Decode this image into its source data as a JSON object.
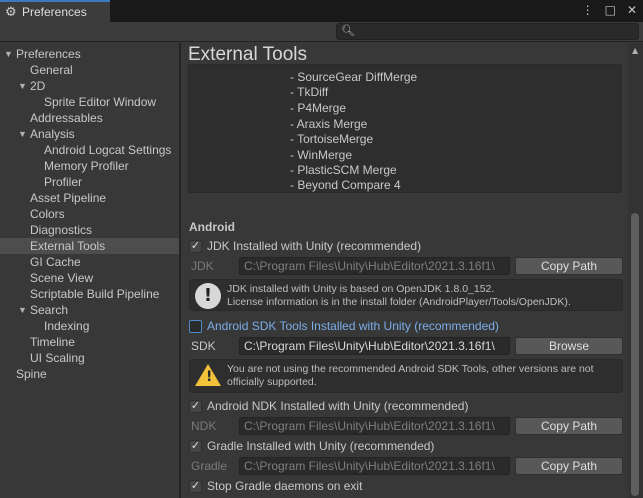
{
  "window": {
    "tab_title": "Preferences",
    "icons": [
      "more-icon",
      "maximize-icon",
      "close-icon"
    ]
  },
  "search": {
    "placeholder": ""
  },
  "sidebar": {
    "items": [
      {
        "label": "Preferences",
        "expanded": true
      },
      {
        "label": "General"
      },
      {
        "label": "2D",
        "expanded": true
      },
      {
        "label": "Sprite Editor Window"
      },
      {
        "label": "Addressables"
      },
      {
        "label": "Analysis",
        "expanded": true
      },
      {
        "label": "Android Logcat Settings"
      },
      {
        "label": "Memory Profiler"
      },
      {
        "label": "Profiler"
      },
      {
        "label": "Asset Pipeline"
      },
      {
        "label": "Colors"
      },
      {
        "label": "Diagnostics"
      },
      {
        "label": "External Tools",
        "selected": true
      },
      {
        "label": "GI Cache"
      },
      {
        "label": "Scene View"
      },
      {
        "label": "Scriptable Build Pipeline"
      },
      {
        "label": "Search",
        "expanded": true
      },
      {
        "label": "Indexing"
      },
      {
        "label": "Timeline"
      },
      {
        "label": "UI Scaling"
      },
      {
        "label": "Spine"
      }
    ]
  },
  "main": {
    "title": "External Tools",
    "diff_tools": [
      "- SourceGear DiffMerge",
      "- TkDiff",
      "- P4Merge",
      "- Araxis Merge",
      "- TortoiseMerge",
      "- WinMerge",
      "- PlasticSCM Merge",
      "- Beyond Compare 4"
    ],
    "android_header": "Android",
    "jdk_check_label": "JDK Installed with Unity (recommended)",
    "jdk_label": "JDK",
    "jdk_path": "C:\\Program Files\\Unity\\Hub\\Editor\\2021.3.16f1\\",
    "copy_path_label": "Copy Path",
    "jdk_info_line1": "JDK installed with Unity is based on OpenJDK 1.8.0_152.",
    "jdk_info_line2": "License information is in the install folder (AndroidPlayer/Tools/OpenJDK).",
    "sdk_check_label": "Android SDK Tools Installed with Unity (recommended)",
    "sdk_label": "SDK",
    "sdk_path": "C:\\Program Files\\Unity\\Hub\\Editor\\2021.3.16f1\\",
    "browse_label": "Browse",
    "sdk_warn_line1": "You are not using the recommended Android SDK Tools, other versions are not",
    "sdk_warn_line2": "officially supported.",
    "ndk_check_label": "Android NDK Installed with Unity (recommended)",
    "ndk_label": "NDK",
    "ndk_path": "C:\\Program Files\\Unity\\Hub\\Editor\\2021.3.16f1\\",
    "gradle_check_label": "Gradle Installed with Unity (recommended)",
    "gradle_label": "Gradle",
    "gradle_path": "C:\\Program Files\\Unity\\Hub\\Editor\\2021.3.16f1\\",
    "stop_gradle_label": "Stop Gradle daemons on exit"
  }
}
